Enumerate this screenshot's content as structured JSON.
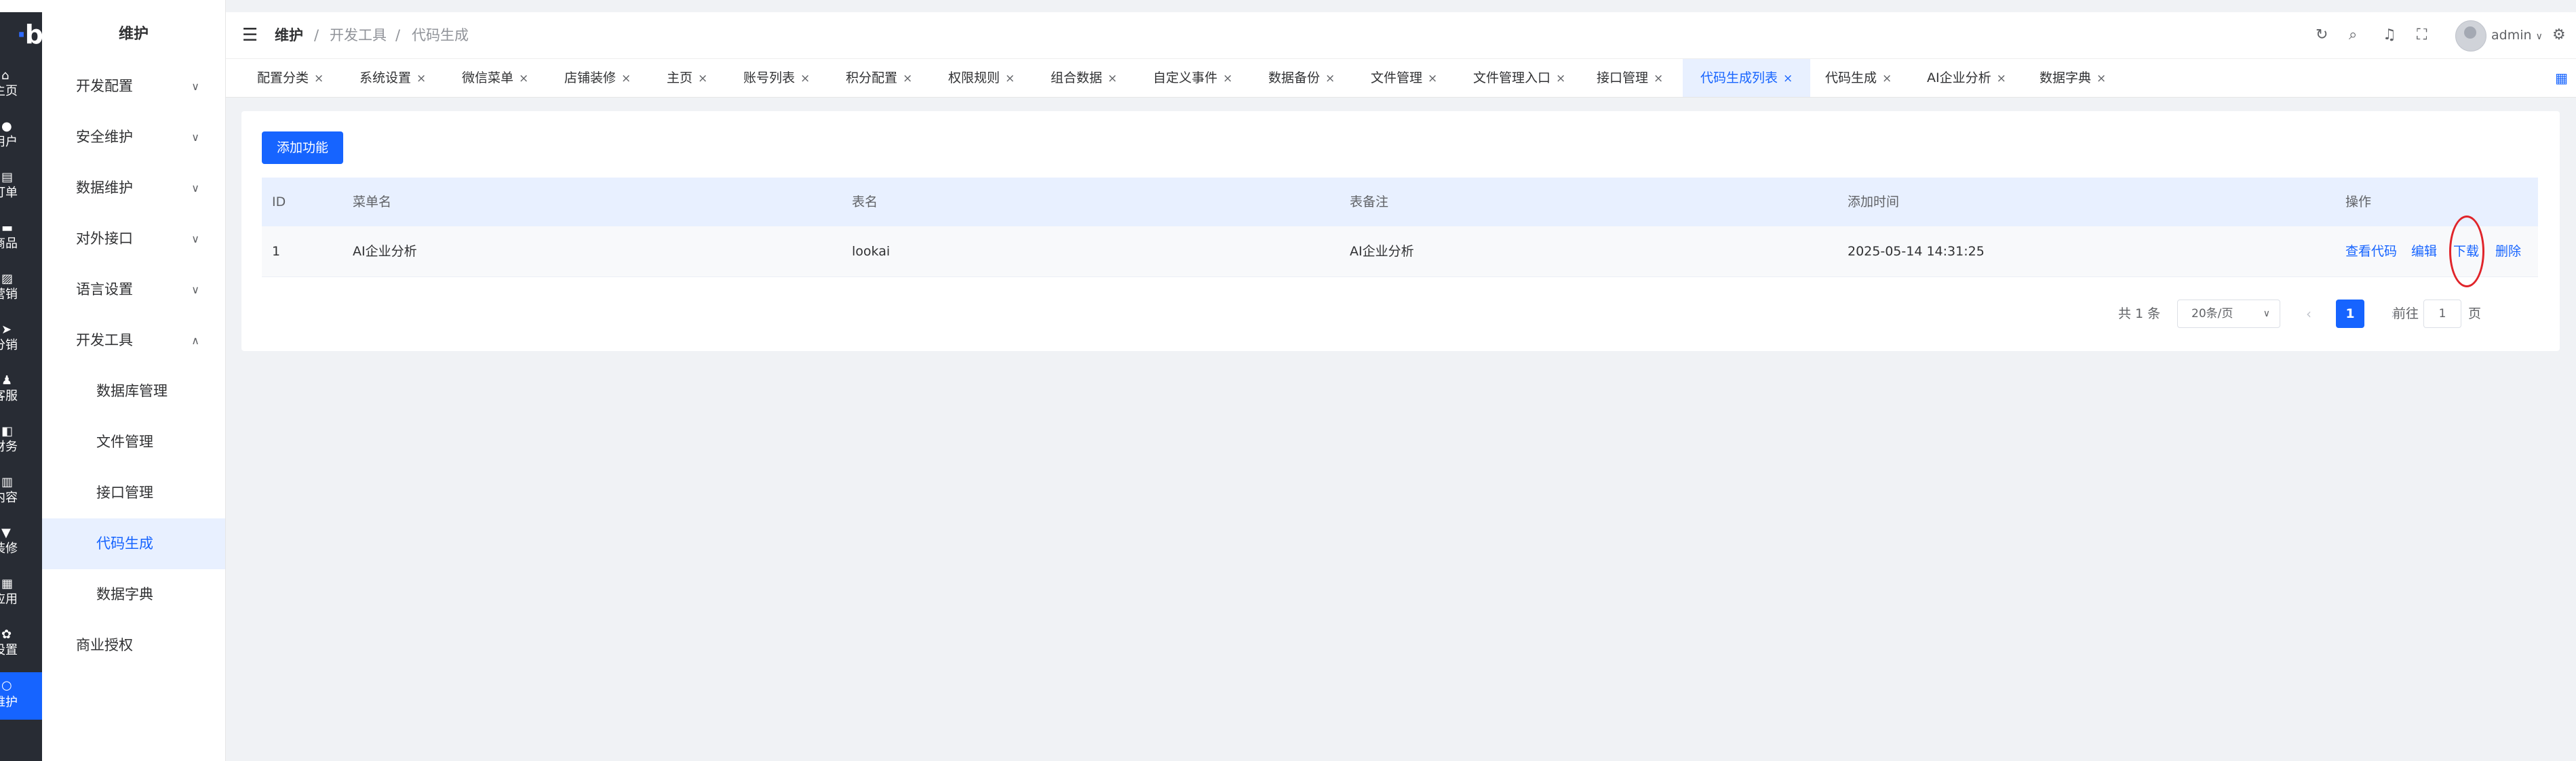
{
  "rail": {
    "logo": "b",
    "items": [
      {
        "label": "主页",
        "icon": "home-icon"
      },
      {
        "label": "用户",
        "icon": "user-icon"
      },
      {
        "label": "订单",
        "icon": "order-icon"
      },
      {
        "label": "商品",
        "icon": "product-icon"
      },
      {
        "label": "营销",
        "icon": "marketing-icon"
      },
      {
        "label": "分销",
        "icon": "distribution-icon"
      },
      {
        "label": "客服",
        "icon": "service-icon"
      },
      {
        "label": "财务",
        "icon": "finance-icon"
      },
      {
        "label": "内容",
        "icon": "content-icon"
      },
      {
        "label": "装修",
        "icon": "decoration-icon"
      },
      {
        "label": "应用",
        "icon": "apps-icon"
      },
      {
        "label": "设置",
        "icon": "settings-icon"
      },
      {
        "label": "维护",
        "icon": "maintenance-icon"
      }
    ]
  },
  "sidebar": {
    "title": "维护",
    "items": [
      {
        "label": "开发配置"
      },
      {
        "label": "安全维护"
      },
      {
        "label": "数据维护"
      },
      {
        "label": "对外接口"
      },
      {
        "label": "语言设置"
      },
      {
        "label": "开发工具"
      },
      {
        "label": "数据库管理"
      },
      {
        "label": "文件管理"
      },
      {
        "label": "接口管理"
      },
      {
        "label": "代码生成"
      },
      {
        "label": "数据字典"
      },
      {
        "label": "商业授权"
      }
    ]
  },
  "header": {
    "breadcrumb": [
      "维护",
      "/",
      "开发工具",
      "/",
      "代码生成"
    ],
    "user_name": "admin"
  },
  "tabs": [
    "配置分类",
    "系统设置",
    "微信菜单",
    "店铺装修",
    "主页",
    "账号列表",
    "积分配置",
    "权限规则",
    "组合数据",
    "自定义事件",
    "数据备份",
    "文件管理",
    "文件管理入口",
    "接口管理",
    "代码生成列表",
    "代码生成",
    "AI企业分析",
    "数据字典"
  ],
  "active_tab": "代码生成列表",
  "main": {
    "add_button": "添加功能",
    "columns": [
      "ID",
      "菜单名",
      "表名",
      "表备注",
      "添加时间",
      "操作"
    ],
    "rows": [
      {
        "id": "1",
        "menu": "AI企业分析",
        "table": "lookai",
        "remark": "AI企业分析",
        "time": "2025-05-14 14:31:25",
        "ops": [
          "查看代码",
          "编辑",
          "下载",
          "删除"
        ]
      }
    ]
  },
  "pagination": {
    "total": "共 1 条",
    "page_size": "20条/页",
    "current": "1",
    "goto_label": "前往",
    "goto_value": "1",
    "page_suffix": "页"
  },
  "colors": {
    "accent": "#1664ff",
    "rail_bg": "#282c34",
    "highlight_circle": "#e0242a"
  }
}
